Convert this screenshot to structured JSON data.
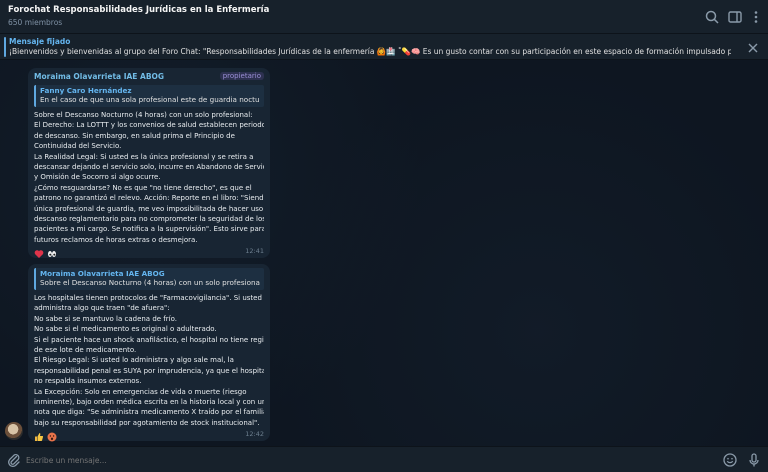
{
  "header": {
    "title": "Forochat Responsabilidades Jurídicas en la Enfermería",
    "subtitle": "650 miembros",
    "icons": [
      "search-icon",
      "sidebar-icon",
      "more-icon"
    ]
  },
  "pinned": {
    "label": "Mensaje fijado",
    "text": "¡Bienvenidos y bienvenidas al grupo del Foro Chat: \"Responsabilidades Jurídicas de la enfermería 🙆🏥 ˚💊🧠 Es un gusto contar con su participación en este espacio de formación impulsado por el Ministerio del P..."
  },
  "messages": [
    {
      "sender": "Moraima Olavarrieta IAE ABOG",
      "badge": "propietario",
      "reply": {
        "name": "Fanny Caro Hernández",
        "text": "En el caso de que una sola profesional este de guardia nocturna..."
      },
      "lines": [
        "Sobre el Descanso Nocturno (4 horas) con un solo profesional:",
        "El Derecho: La LOTTT y los convenios de salud establecen periodos",
        "de descanso. Sin embargo, en salud prima el Principio de",
        "Continuidad del Servicio.",
        "La Realidad Legal: Si usted es la única profesional y se retira a",
        "descansar dejando el servicio solo, incurre en Abandono de Servicio",
        "y Omisión de Socorro si algo ocurre.",
        "¿Cómo resguardarse? No es que \"no tiene derecho\", es que el",
        "patrono no garantizó el relevo. Acción: Reporte en el libro: \"Siendo la",
        "única profesional de guardia, me veo imposibilitada de hacer uso del",
        "descanso reglamentario para no comprometer la seguridad de los X",
        "pacientes a mi cargo. Se notifica a la supervisión\". Esto sirve para",
        "futuros reclamos de horas extras o desmejora."
      ],
      "reactions": [
        "❤️",
        "👀"
      ],
      "time": "12:41"
    },
    {
      "sender": "",
      "badge": "",
      "reply": {
        "name": "Moraima Olavarrieta IAE ABOG",
        "text": "Sobre el Descanso Nocturno (4 horas) con un solo profesional: El..."
      },
      "lines": [
        "Los hospitales tienen protocolos de \"Farmacovigilancia\". Si usted",
        "administra algo que traen \"de afuera\":",
        "No sabe si se mantuvo la cadena de frío.",
        "No sabe si el medicamento es original o adulterado.",
        "Si el paciente hace un shock anafiláctico, el hospital no tiene registro",
        "de ese lote de medicamento.",
        "El Riesgo Legal: Si usted lo administra y algo sale mal, la",
        "responsabilidad penal es SUYA por imprudencia, ya que el hospital",
        "no respalda insumos externos.",
        "La Excepción: Solo en emergencias de vida o muerte (riesgo",
        "inminente), bajo orden médica escrita en la historia local y con una",
        "nota que diga: \"Se administra medicamento X traído por el familiar",
        "bajo su responsabilidad por agotamiento de stock institucional\"."
      ],
      "reactions": [
        "👍",
        "😮"
      ],
      "time": "12:42"
    }
  ],
  "composer": {
    "placeholder": "Escribe un mensaje...",
    "icons": [
      "attach-icon",
      "emoji-icon",
      "microphone-icon"
    ]
  },
  "colors": {
    "background": "#0e1621",
    "panel": "#17212b",
    "bubble": "#182533",
    "accent": "#64b5ef",
    "sender": "#72bce6"
  }
}
